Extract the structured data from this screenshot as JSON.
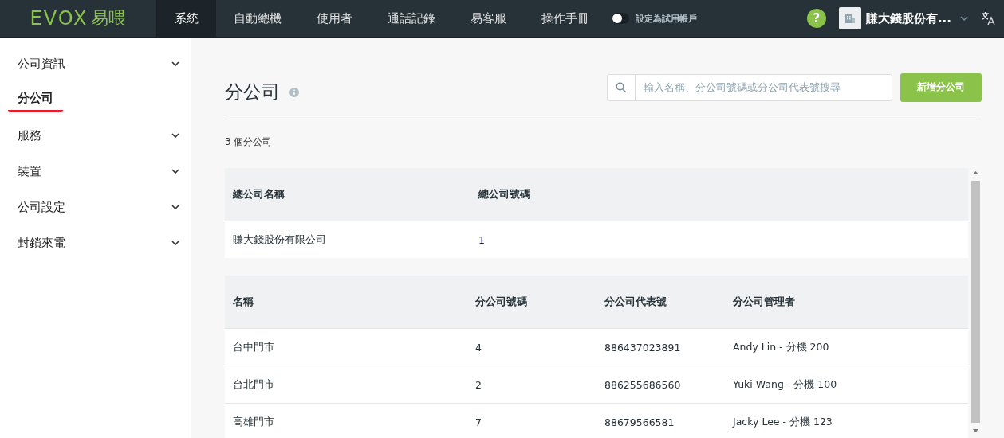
{
  "topbar": {
    "logo_text": "EVOX",
    "logo_suffix": "易喂",
    "nav": [
      {
        "label": "系統",
        "selected": true
      },
      {
        "label": "自動總機",
        "selected": false
      },
      {
        "label": "使用者",
        "selected": false
      },
      {
        "label": "通話記錄",
        "selected": false
      },
      {
        "label": "易客服",
        "selected": false
      },
      {
        "label": "操作手冊",
        "selected": false
      }
    ],
    "trial_toggle": {
      "label": "設定為試用帳戶",
      "on": false
    },
    "help": "?",
    "company": "賺大錢股份有..."
  },
  "sidebar": {
    "items": [
      {
        "kind": "group",
        "label": "公司資訊",
        "selected": false
      },
      {
        "kind": "link",
        "label": "分公司",
        "selected": true
      },
      {
        "kind": "group",
        "label": "服務",
        "selected": false
      },
      {
        "kind": "group",
        "label": "裝置",
        "selected": false
      },
      {
        "kind": "group",
        "label": "公司設定",
        "selected": false
      },
      {
        "kind": "group",
        "label": "封鎖來電",
        "selected": false
      }
    ]
  },
  "page": {
    "title": "分公司",
    "search": {
      "placeholder": "輸入名稱、分公司號碼或分公司代表號搜尋"
    },
    "add_button": "新增分公司",
    "count": "3 個分公司"
  },
  "head_office_table": {
    "columns": [
      "總公司名稱",
      "總公司號碼"
    ],
    "rows": [
      [
        "賺大錢股份有限公司",
        "1"
      ]
    ]
  },
  "branch_table": {
    "columns": [
      "名稱",
      "分公司號碼",
      "分公司代表號",
      "分公司管理者"
    ],
    "rows": [
      [
        "台中門市",
        "4",
        "886437023891",
        "Andy Lin - 分機 200"
      ],
      [
        "台北門市",
        "2",
        "886255686560",
        "Yuki Wang - 分機 100"
      ],
      [
        "高雄門市",
        "7",
        "88679566581",
        "Jacky Lee - 分機 123"
      ]
    ]
  }
}
